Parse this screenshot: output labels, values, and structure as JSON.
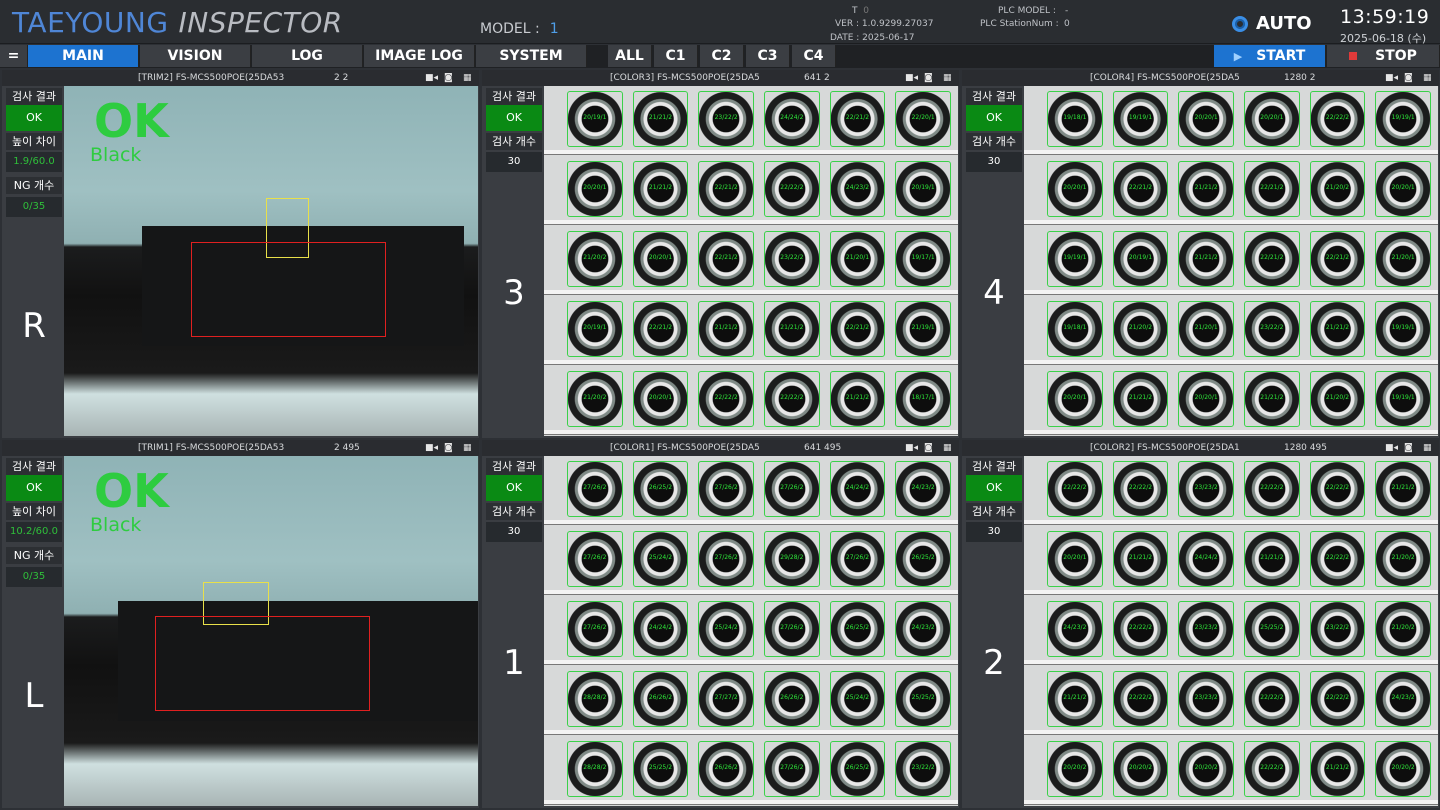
{
  "header": {
    "brand1": "TAEYOUNG",
    "brand2": "INSPECTOR",
    "model_label": "MODEL :",
    "model_value": "1",
    "t_label": "T",
    "t_value": "0",
    "ver": "VER : 1.0.9299.27037",
    "date_line": "DATE : 2025-06-17",
    "plc_model_label": "PLC MODEL :",
    "plc_model_value": "-",
    "plc_station_label": "PLC StationNum :",
    "plc_station_value": "0",
    "mode": "AUTO",
    "time": "13:59:19",
    "date": "2025-06-18 (수)",
    "menu_icon": "="
  },
  "nav": {
    "main": "MAIN",
    "vision": "VISION",
    "log": "LOG",
    "image_log": "IMAGE LOG",
    "system": "SYSTEM",
    "all": "ALL",
    "c1": "C1",
    "c2": "C2",
    "c3": "C3",
    "c4": "C4",
    "start": "START",
    "stop": "STOP"
  },
  "labels": {
    "result": "검사 결과",
    "height": "높이 차이",
    "ng": "NG 개수",
    "count": "검사 개수"
  },
  "panels": {
    "trim2": {
      "title": "[TRIM2]  FS-MCS500POE(25DA53",
      "num": "2  2",
      "result": "OK",
      "height": "1.9/60.0",
      "ng": "0/35",
      "side": "R",
      "ok": "OK",
      "sub": "Black"
    },
    "color3": {
      "title": "[COLOR3]  FS-MCS500POE(25DA5",
      "num": "641  2",
      "result": "OK",
      "count": "30",
      "side": "3"
    },
    "color4": {
      "title": "[COLOR4]  FS-MCS500POE(25DA5",
      "num": "1280  2",
      "result": "OK",
      "count": "30",
      "side": "4"
    },
    "trim1": {
      "title": "[TRIM1]  FS-MCS500POE(25DA53",
      "num": "2  495",
      "result": "OK",
      "height": "10.2/60.0",
      "ng": "0/35",
      "side": "L",
      "ok": "OK",
      "sub": "Black"
    },
    "color1": {
      "title": "[COLOR1]  FS-MCS500POE(25DA5",
      "num": "641  495",
      "result": "OK",
      "count": "30",
      "side": "1"
    },
    "color2": {
      "title": "[COLOR2]  FS-MCS500POE(25DA1",
      "num": "1280  495",
      "result": "OK",
      "count": "30",
      "side": "2"
    }
  },
  "grids": {
    "color3": [
      [
        "20/19/1",
        "21/21/2",
        "23/22/2",
        "24/24/2",
        "22/21/2",
        "22/20/1"
      ],
      [
        "20/20/1",
        "21/21/2",
        "22/21/2",
        "22/22/2",
        "24/23/2",
        "20/19/1"
      ],
      [
        "21/20/2",
        "20/20/1",
        "22/21/2",
        "23/22/2",
        "21/20/1",
        "19/17/1"
      ],
      [
        "20/19/1",
        "22/21/2",
        "21/21/2",
        "21/21/2",
        "22/21/2",
        "21/19/1"
      ],
      [
        "21/20/2",
        "20/20/1",
        "22/22/2",
        "22/22/2",
        "21/21/2",
        "18/17/1"
      ]
    ],
    "color4": [
      [
        "19/18/1",
        "19/19/1",
        "20/20/1",
        "20/20/1",
        "22/22/2",
        "19/19/1"
      ],
      [
        "20/20/1",
        "22/21/2",
        "21/21/2",
        "22/21/2",
        "21/20/2",
        "20/20/1"
      ],
      [
        "19/19/1",
        "20/19/1",
        "21/21/2",
        "22/21/2",
        "22/21/2",
        "21/20/1"
      ],
      [
        "19/18/1",
        "21/20/2",
        "21/20/1",
        "23/22/2",
        "21/21/2",
        "19/19/1"
      ],
      [
        "20/20/1",
        "21/21/2",
        "20/20/1",
        "21/21/2",
        "21/20/2",
        "19/19/1"
      ]
    ],
    "color1": [
      [
        "27/26/2",
        "26/25/2",
        "27/26/2",
        "27/26/2",
        "24/24/2",
        "24/23/2"
      ],
      [
        "27/26/2",
        "25/24/2",
        "27/26/2",
        "29/28/2",
        "27/26/2",
        "26/25/2"
      ],
      [
        "27/26/2",
        "24/24/2",
        "25/24/2",
        "27/26/2",
        "26/25/2",
        "24/23/2"
      ],
      [
        "28/28/2",
        "26/26/2",
        "27/27/2",
        "26/26/2",
        "25/24/2",
        "25/25/2"
      ],
      [
        "28/28/2",
        "25/25/2",
        "26/26/2",
        "27/26/2",
        "26/25/2",
        "23/22/2"
      ]
    ],
    "color2": [
      [
        "22/22/2",
        "22/22/2",
        "23/23/2",
        "22/22/2",
        "22/22/2",
        "21/21/2"
      ],
      [
        "20/20/1",
        "21/21/2",
        "24/24/2",
        "21/21/2",
        "22/22/2",
        "21/20/2"
      ],
      [
        "24/23/2",
        "22/22/2",
        "23/23/2",
        "25/25/2",
        "23/22/2",
        "21/20/2"
      ],
      [
        "21/21/2",
        "22/22/2",
        "23/23/2",
        "22/22/2",
        "22/22/2",
        "24/23/2"
      ],
      [
        "20/20/2",
        "20/20/2",
        "20/20/2",
        "22/22/2",
        "21/21/2",
        "20/20/2"
      ]
    ]
  },
  "colors": {
    "accent": "#1d73d0",
    "ok_green": "#2ecc40",
    "ok_box": "#0a8a14",
    "stop_red": "#e03a3a"
  },
  "icons": {
    "video": "video-camera-icon",
    "photo": "camera-icon",
    "keyboard": "keyboard-icon",
    "play": "play-icon",
    "stop": "stop-icon",
    "auto": "ring-icon"
  }
}
